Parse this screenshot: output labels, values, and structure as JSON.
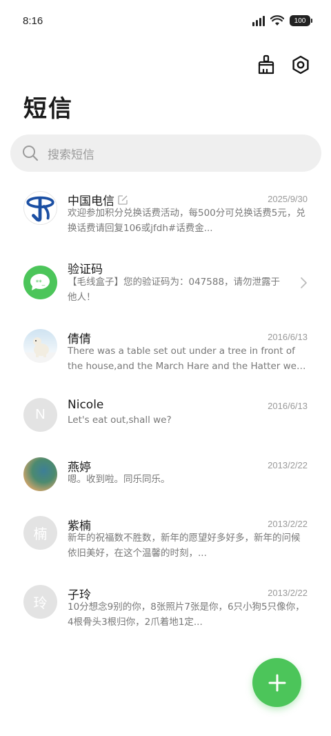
{
  "status_bar": {
    "time": "8:16",
    "battery": "100"
  },
  "header": {
    "title": "短信",
    "clean_icon": "broom-icon",
    "settings_icon": "gear-icon"
  },
  "search": {
    "placeholder": "搜索短信"
  },
  "conversations": [
    {
      "name": "中国电信",
      "date": "2025/9/30",
      "preview": "欢迎参加积分兑换话费活动，每500分可兑换话费5元，兑换话费请回复106或jfdh#话费金...",
      "avatar": "china-telecom-logo",
      "has_edit_badge": true
    },
    {
      "name": "验证码",
      "date": "",
      "preview": "【毛线盒子】您的验证码为：047588，请勿泄露于他人！",
      "avatar": "verification-code-icon",
      "has_chevron": true
    },
    {
      "name": "倩倩",
      "date": "2016/6/13",
      "preview": "There was a table set out under a tree in front of the house,and the March Hare and the Hatter were havin ...",
      "avatar": "polar-bear-photo"
    },
    {
      "name": "Nicole",
      "date": "2016/6/13",
      "preview": "Let's eat out,shall we?",
      "avatar_initial": "N"
    },
    {
      "name": "燕婷",
      "date": "2013/2/22",
      "preview": "嗯。收到啦。同乐同乐。",
      "avatar": "landscape-photo"
    },
    {
      "name": "紫楠",
      "date": "2013/2/22",
      "preview": "新年的祝福数不胜数，新年的愿望好多好多，新年的问候依旧美好，在这个温馨的时刻，...",
      "avatar_initial": "楠"
    },
    {
      "name": "子玲",
      "date": "2013/2/22",
      "preview": "10分想念9别的你，8张照片7张是你，6只小狗5只像你，4根骨头3根归你，2爪着地1定...",
      "avatar_initial": "玲"
    }
  ],
  "fab": {
    "icon": "plus-icon",
    "color": "#4cc55a"
  }
}
